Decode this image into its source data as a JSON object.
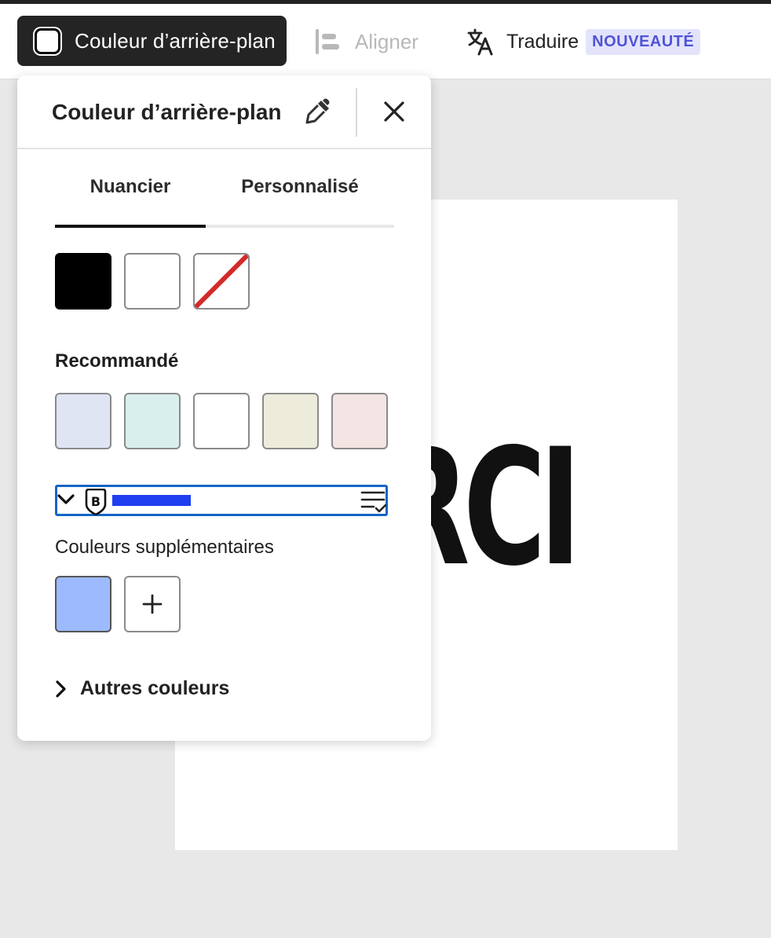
{
  "toolbar": {
    "background_color_label": "Couleur d’arrière-plan",
    "align_label": "Aligner",
    "translate_label": "Traduire",
    "new_badge": "NOUVEAUTÉ"
  },
  "canvas": {
    "visible_text": "RCI"
  },
  "panel": {
    "title": "Couleur d’arrière-plan",
    "tabs": [
      {
        "label": "Nuancier",
        "active": true
      },
      {
        "label": "Personnalisé",
        "active": false
      }
    ],
    "basic_swatches": [
      {
        "name": "black",
        "color": "#000000"
      },
      {
        "name": "white",
        "color": "#ffffff"
      },
      {
        "name": "none",
        "color": "transparent"
      }
    ],
    "recommended_label": "Recommandé",
    "recommended_swatches": [
      "#dfe5f3",
      "#d9efee",
      "#ffffff",
      "#edecdb",
      "#f3e5e3"
    ],
    "extension_bar": {
      "text_redacted": true
    },
    "additional_label": "Couleurs supplémentaires",
    "additional_swatches": [
      "#9dbafe"
    ],
    "more_colors_label": "Autres couleurs"
  },
  "colors": {
    "accent_extension": "#1465c7",
    "badge_bg": "#e3e4fb",
    "badge_text": "#5153d6",
    "no_color_slash": "#d42a2a"
  },
  "icons": {
    "toolbar": [
      "swatch-icon",
      "align-left-icon",
      "translate-icon"
    ],
    "panel": [
      "eyedropper-icon",
      "close-icon",
      "chevron-down-icon",
      "shield-b-icon",
      "list-check-icon",
      "plus-icon",
      "chevron-right-icon"
    ]
  }
}
